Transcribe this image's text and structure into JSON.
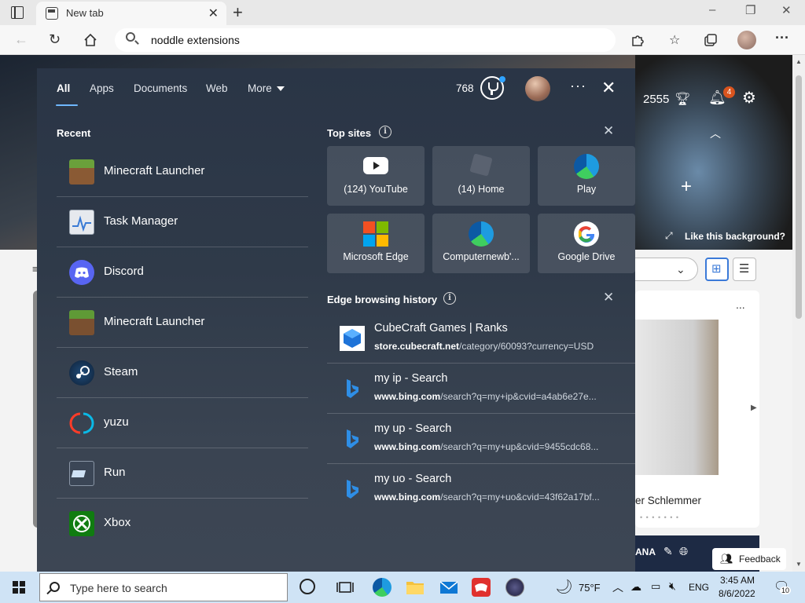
{
  "browser": {
    "tab_title": "New tab",
    "address_text": "noddle extensions",
    "win_minimize": "–",
    "win_restore": "❐",
    "win_close": "✕"
  },
  "ntp": {
    "points": "2555",
    "notif_count": "4",
    "like_bg": "Like this background?",
    "card_caption": "er Schlemmer",
    "card_dots": "• • • • • • •",
    "bottom_strip_text": "ANA",
    "feedback_label": "Feedback",
    "card_more": "..."
  },
  "flyout": {
    "tabs": [
      {
        "label": "All"
      },
      {
        "label": "Apps"
      },
      {
        "label": "Documents"
      },
      {
        "label": "Web"
      },
      {
        "label": "More"
      }
    ],
    "points": "768",
    "recent_title": "Recent",
    "recent": [
      {
        "label": "Minecraft Launcher",
        "icon": "minecraft-icon"
      },
      {
        "label": "Task Manager",
        "icon": "task-manager-icon"
      },
      {
        "label": "Discord",
        "icon": "discord-icon"
      },
      {
        "label": "Minecraft Launcher",
        "icon": "minecraft-icon"
      },
      {
        "label": "Steam",
        "icon": "steam-icon"
      },
      {
        "label": "yuzu",
        "icon": "yuzu-icon"
      },
      {
        "label": "Run",
        "icon": "run-icon"
      },
      {
        "label": "Xbox",
        "icon": "xbox-icon"
      }
    ],
    "top_sites_title": "Top sites",
    "top_sites": [
      {
        "label": "(124) YouTube",
        "icon": "youtube-icon"
      },
      {
        "label": "(14) Home",
        "icon": "roblox-icon"
      },
      {
        "label": "Play",
        "icon": "edge-icon"
      },
      {
        "label": "Microsoft Edge",
        "icon": "microsoft-icon"
      },
      {
        "label": "Computernewb'...",
        "icon": "edge-icon"
      },
      {
        "label": "Google Drive",
        "icon": "google-icon"
      }
    ],
    "history_title": "Edge browsing history",
    "history": [
      {
        "title": "CubeCraft Games | Ranks",
        "domain": "store.cubecraft.net",
        "path": "/category/60093?currency=USD",
        "icon": "cubecraft-icon"
      },
      {
        "title": "my ip - Search",
        "domain": "www.bing.com",
        "path": "/search?q=my+ip&cvid=a4ab6e27e...",
        "icon": "bing-icon"
      },
      {
        "title": "my up - Search",
        "domain": "www.bing.com",
        "path": "/search?q=my+up&cvid=9455cdc68...",
        "icon": "bing-icon"
      },
      {
        "title": "my uo - Search",
        "domain": "www.bing.com",
        "path": "/search?q=my+uo&cvid=43f62a17bf...",
        "icon": "bing-icon"
      }
    ]
  },
  "taskbar": {
    "search_placeholder": "Type here to search",
    "weather": "75°F",
    "lang": "ENG",
    "time": "3:45 AM",
    "date": "8/6/2022",
    "notif_count": "10"
  }
}
